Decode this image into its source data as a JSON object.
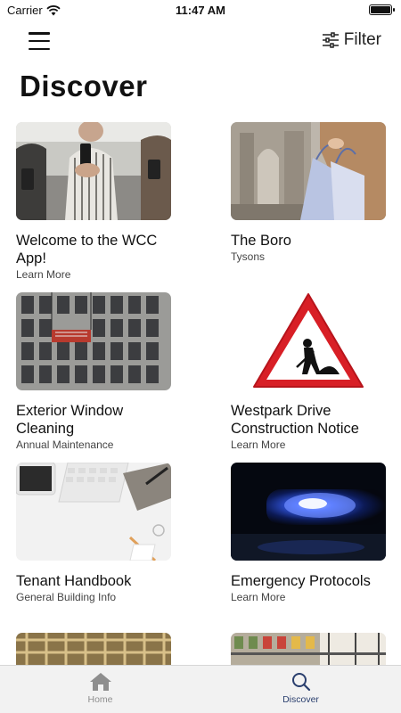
{
  "status_bar": {
    "carrier": "Carrier",
    "time": "11:47 AM"
  },
  "nav": {
    "filter_label": "Filter"
  },
  "page_title": "Discover",
  "cards": [
    {
      "title": "Welcome to the WCC App!",
      "subtitle": "Learn More",
      "image": "people-with-phones-photo"
    },
    {
      "title": "The Boro",
      "subtitle": "Tysons",
      "image": "shopping-bags-photo"
    },
    {
      "title": "Exterior Window Cleaning",
      "subtitle": "Annual Maintenance",
      "image": "building-facade-photo"
    },
    {
      "title": "Westpark Drive Construction Notice",
      "subtitle": "Learn More",
      "image": "road-work-sign"
    },
    {
      "title": "Tenant Handbook",
      "subtitle": "General Building Info",
      "image": "desk-workspace-photo"
    },
    {
      "title": "Emergency Protocols",
      "subtitle": "Learn More",
      "image": "police-light-photo"
    },
    {
      "title": "",
      "subtitle": "",
      "image": "ceiling-grid-photo"
    },
    {
      "title": "",
      "subtitle": "",
      "image": "market-shelves-photo"
    }
  ],
  "tab_bar": {
    "items": [
      {
        "label": "Home",
        "icon": "home-icon",
        "active": false
      },
      {
        "label": "Discover",
        "icon": "search-icon",
        "active": true
      }
    ]
  },
  "colors": {
    "active_tab": "#2a3f6e",
    "inactive_tab": "#8e8e8e",
    "tab_bar_bg": "#f2f2f2"
  }
}
